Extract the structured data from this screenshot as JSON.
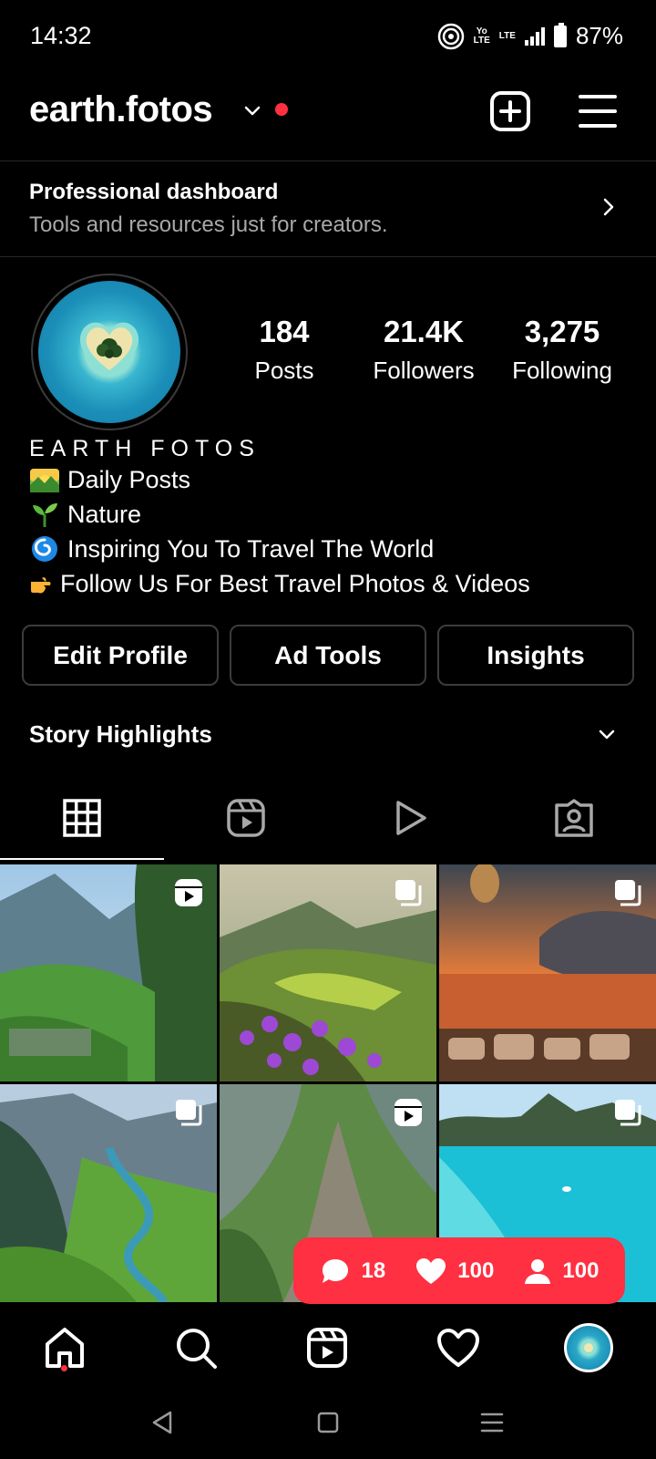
{
  "status_bar": {
    "time": "14:32",
    "network_label_top": "Yo",
    "network_label_bottom": "LTE",
    "lte_label": "LTE",
    "battery": "87%"
  },
  "header": {
    "username": "earth.fotos"
  },
  "dashboard": {
    "title": "Professional dashboard",
    "subtitle": "Tools and resources just for creators."
  },
  "profile": {
    "stats": [
      {
        "value": "184",
        "label": "Posts"
      },
      {
        "value": "21.4K",
        "label": "Followers"
      },
      {
        "value": "3,275",
        "label": "Following"
      }
    ],
    "display_name": "EARTH FOTOS",
    "bio_lines": [
      {
        "emoji": "sunrise-over-mountains",
        "text": "Daily Posts"
      },
      {
        "emoji": "seedling",
        "text": "Nature"
      },
      {
        "emoji": "cyclone",
        "text": "Inspiring You To Travel The World"
      },
      {
        "emoji": "pointing-hand",
        "text": "Follow Us For Best Travel Photos & Videos"
      }
    ]
  },
  "actions": {
    "edit_profile": "Edit Profile",
    "ad_tools": "Ad Tools",
    "insights": "Insights"
  },
  "highlights": {
    "label": "Story Highlights"
  },
  "tabs": [
    "grid-icon",
    "reels-icon",
    "play-icon",
    "tagged-icon"
  ],
  "grid": [
    {
      "badge": "reel-icon"
    },
    {
      "badge": "carousel-icon"
    },
    {
      "badge": "carousel-icon"
    },
    {
      "badge": "carousel-icon"
    },
    {
      "badge": "reel-icon"
    },
    {
      "badge": "carousel-icon"
    }
  ],
  "notifications": {
    "comments": "18",
    "likes": "100",
    "follows": "100"
  },
  "colors": {
    "accent_red": "#ff3041",
    "background": "#000000",
    "muted_text": "#a8a8a8",
    "border": "#3c3c3c"
  }
}
